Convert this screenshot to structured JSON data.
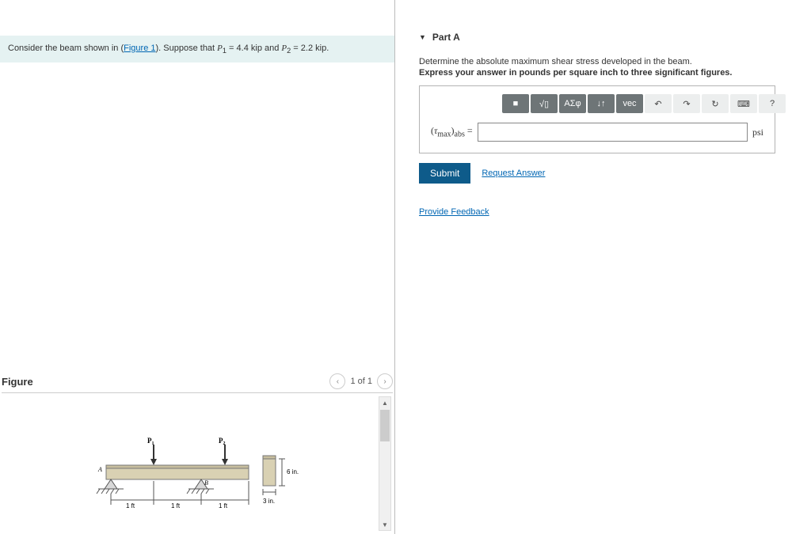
{
  "problem": {
    "prefix": "Consider the beam shown in (",
    "figure_link": "Figure 1",
    "middle": "). Suppose that ",
    "p1var": "P",
    "p1sub": "1",
    "p1val": " = 4.4 kip",
    "and": " and ",
    "p2var": "P",
    "p2sub": "2",
    "p2val": " = 2.2 kip",
    "end": "."
  },
  "figure": {
    "title": "Figure",
    "counter": "1 of 1",
    "labels": {
      "P1": "P",
      "P1sub": "1",
      "P2": "P",
      "P2sub": "2",
      "A": "A",
      "B": "B",
      "d1": "1 ft",
      "d2": "1 ft",
      "d3": "1 ft",
      "h": "6 in.",
      "w": "3 in."
    }
  },
  "partA": {
    "title": "Part A",
    "instr": "Determine the absolute maximum shear stress developed in the beam.",
    "instr_bold": "Express your answer in pounds per square inch to three significant figures.",
    "label_open": "(",
    "label_tau": "τ",
    "label_sub": "max",
    "label_close": ")",
    "label_abs": "abs",
    "equals": " =",
    "unit": "psi",
    "submit": "Submit",
    "request": "Request Answer",
    "toolbar": {
      "templates": "■",
      "frac": "√▯",
      "greek": "ΑΣφ",
      "scripts": "↓↑",
      "vec": "vec",
      "undo": "↶",
      "redo": "↷",
      "reset": "↻",
      "keyboard": "⌨",
      "help": "?"
    }
  },
  "feedback": "Provide Feedback"
}
